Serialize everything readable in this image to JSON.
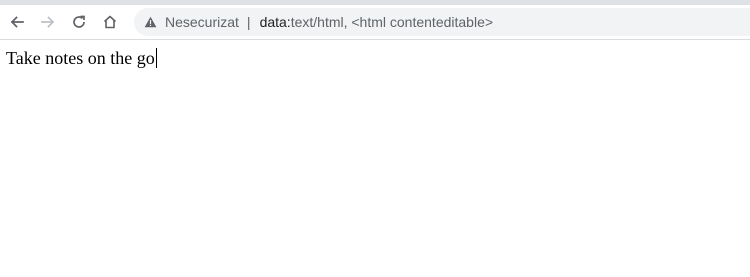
{
  "browser": {
    "security_label": "Nesecurizat",
    "separator": "|",
    "url_scheme": "data:",
    "url_rest": "text/html, <html contenteditable>",
    "icons": {
      "back": "back-arrow-icon",
      "forward": "forward-arrow-icon",
      "reload": "reload-icon",
      "home": "home-icon",
      "warning": "warning-triangle-icon"
    },
    "colors": {
      "toolbar_bg": "#ffffff",
      "omnibox_bg": "#f1f3f4",
      "icon_active": "#5f6368",
      "icon_disabled": "#bdc1c6"
    }
  },
  "page": {
    "text": "Take notes on the go"
  }
}
